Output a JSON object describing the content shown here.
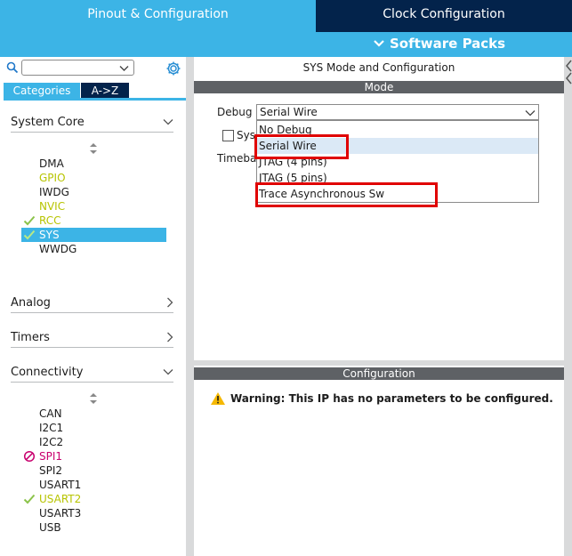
{
  "header": {
    "tab_pinout": "Pinout & Configuration",
    "tab_clock": "Clock Configuration",
    "software_packs": "Software Packs"
  },
  "sidebar": {
    "search_value": "",
    "tab_categories": "Categories",
    "tab_az": "A->Z",
    "groups": {
      "system_core": "System Core",
      "analog": "Analog",
      "timers": "Timers",
      "connectivity": "Connectivity"
    },
    "system_core_items": [
      {
        "label": "DMA",
        "status": "none"
      },
      {
        "label": "GPIO",
        "status": "configured"
      },
      {
        "label": "IWDG",
        "status": "none"
      },
      {
        "label": "NVIC",
        "status": "configured"
      },
      {
        "label": "RCC",
        "status": "checked"
      },
      {
        "label": "SYS",
        "status": "checked-selected"
      },
      {
        "label": "WWDG",
        "status": "none"
      }
    ],
    "connectivity_items": [
      {
        "label": "CAN",
        "status": "none"
      },
      {
        "label": "I2C1",
        "status": "none"
      },
      {
        "label": "I2C2",
        "status": "none"
      },
      {
        "label": "SPI1",
        "status": "conflict"
      },
      {
        "label": "SPI2",
        "status": "none"
      },
      {
        "label": "USART1",
        "status": "none"
      },
      {
        "label": "USART2",
        "status": "checked"
      },
      {
        "label": "USART3",
        "status": "none"
      },
      {
        "label": "USB",
        "status": "none"
      }
    ]
  },
  "mode_panel": {
    "title": "SYS Mode and Configuration",
    "section": "Mode",
    "debug_label": "Debug",
    "debug_value": "Serial Wire",
    "sys_checkbox_label": "Sys",
    "timebase_label": "Timeba",
    "debug_options": [
      "No Debug",
      "Serial Wire",
      "JTAG (4 pins)",
      "JTAG (5 pins)",
      "Trace Asynchronous Sw"
    ],
    "highlighted_option": "Serial Wire"
  },
  "config_panel": {
    "section": "Configuration",
    "warning": "Warning: This IP has no parameters to be configured."
  },
  "colors": {
    "accent_blue": "#3cb4e6",
    "dark_navy": "#03234b",
    "section_gray": "#5e6165",
    "configured_yellow": "#b7c400",
    "check_green": "#8bc34a",
    "conflict_magenta": "#c8006e",
    "annotation_red": "#e00000"
  }
}
